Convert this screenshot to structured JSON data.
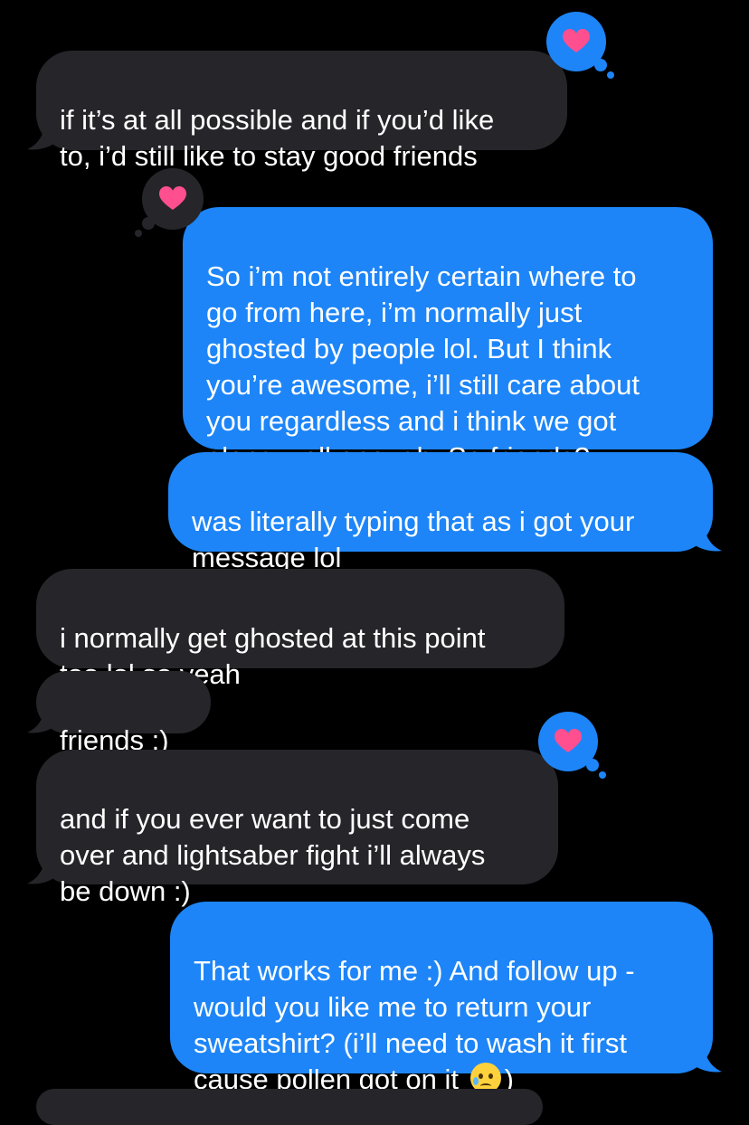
{
  "messages": [
    {
      "id": "m1",
      "side": "incoming",
      "text": "if it’s at all possible and if you’d like\nto, i’d still like to stay good friends",
      "reaction": "heart"
    },
    {
      "id": "m2",
      "side": "outgoing",
      "text": "So i’m not entirely certain where to\ngo from here, i’m normally just\nghosted by people lol. But I think\nyou’re awesome, i’ll still care about\nyou regardless and i think we got\nalong well enough. So friends?",
      "reaction": "heart"
    },
    {
      "id": "m3",
      "side": "outgoing",
      "text": "was literally typing that as i got your\nmessage lol"
    },
    {
      "id": "m4",
      "side": "incoming",
      "text": "i normally get ghosted at this point\ntoo lol so yeah"
    },
    {
      "id": "m5",
      "side": "incoming",
      "text": "friends :)"
    },
    {
      "id": "m6",
      "side": "incoming",
      "text": "and if you ever want to just come\nover and lightsaber fight i’ll always\nbe down :)",
      "reaction": "heart"
    },
    {
      "id": "m7",
      "side": "outgoing",
      "text_before_emoji": "That works for me :) And follow up -\nwould you like me to return your\nsweatshirt? (i’ll need to wash it first\ncause pollen got on it ",
      "emoji": "face-holding-back-tears-icon",
      "text_after_emoji": ")"
    }
  ],
  "colors": {
    "background": "#000000",
    "incoming_bubble": "#26252a",
    "outgoing_bubble": "#1d85f8",
    "heart": "#ff4f8e",
    "text": "#ffffff"
  }
}
